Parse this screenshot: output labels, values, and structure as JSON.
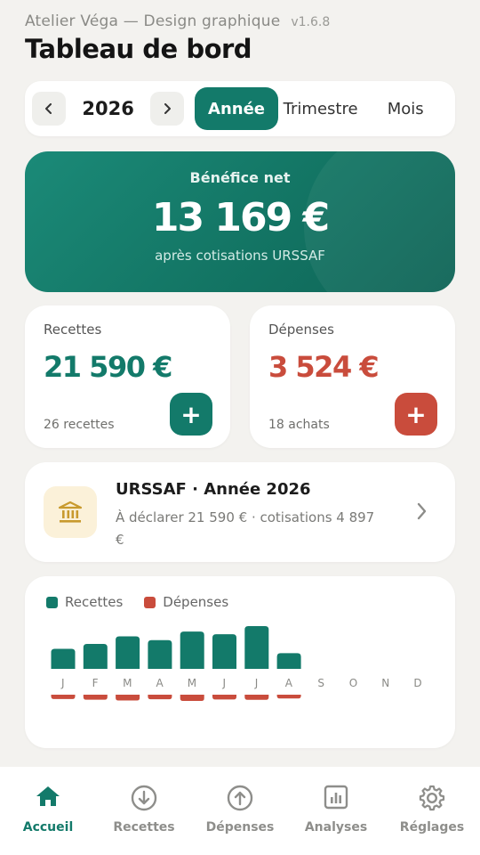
{
  "header": {
    "app_name": "Atelier Véga — Design graphique",
    "version": "v1.6.8",
    "title": "Tableau de bord"
  },
  "period": {
    "prev_icon": "chevron-left-icon",
    "year": "2026",
    "next_icon": "chevron-right-icon",
    "segments": [
      "Année",
      "Trimestre",
      "Mois"
    ],
    "active_segment": "Année"
  },
  "profit": {
    "label": "Bénéfice net",
    "value": "13 169 €",
    "subtitle": "après cotisations URSSAF"
  },
  "income": {
    "label": "Recettes",
    "value": "21 590 €",
    "count": "26 recettes",
    "add_label": "+"
  },
  "expense": {
    "label": "Dépenses",
    "value": "3 524 €",
    "count": "18 achats",
    "add_label": "+"
  },
  "urssaf": {
    "icon": "bank-icon",
    "title": "URSSAF · Année 2026",
    "description": "À déclarer 21 590 € · cotisations 4 897 €"
  },
  "chart_data": {
    "type": "bar",
    "categories": [
      "J",
      "F",
      "M",
      "A",
      "M",
      "J",
      "J",
      "A",
      "S",
      "O",
      "N",
      "D"
    ],
    "series": [
      {
        "name": "Recettes",
        "values": [
          1850,
          2300,
          3000,
          2650,
          3450,
          3200,
          3950,
          1450,
          0,
          0,
          0,
          0
        ]
      },
      {
        "name": "Dépenses",
        "values": [
          360,
          420,
          480,
          380,
          520,
          400,
          430,
          320,
          0,
          0,
          0,
          0
        ]
      }
    ],
    "legend": [
      "Recettes",
      "Dépenses"
    ],
    "colors": {
      "Recettes": "#137a6a",
      "Dépenses": "#c94c3c"
    }
  },
  "nav": {
    "items": [
      {
        "label": "Accueil",
        "icon": "home-icon"
      },
      {
        "label": "Recettes",
        "icon": "arrow-down-circle-icon"
      },
      {
        "label": "Dépenses",
        "icon": "arrow-up-circle-icon"
      },
      {
        "label": "Analyses",
        "icon": "bar-chart-icon"
      },
      {
        "label": "Réglages",
        "icon": "gear-icon"
      }
    ],
    "active": "Accueil"
  },
  "colors": {
    "accent": "#137a6a",
    "danger": "#c94c3c",
    "background": "#f3f2ef",
    "card": "#ffffff"
  }
}
